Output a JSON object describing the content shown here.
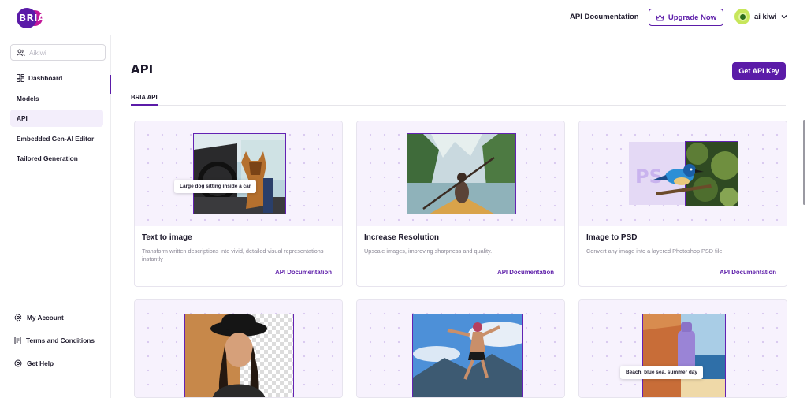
{
  "brand": {
    "logo_text": "BRIA",
    "primary": "#5b1ba8",
    "accent": "#c3179a"
  },
  "header": {
    "api_doc": "API Documentation",
    "upgrade": "Upgrade Now",
    "user_name": "ai kiwi"
  },
  "sidebar": {
    "search_value": "Aikiwi",
    "items": [
      {
        "label": "Dashboard",
        "icon": "dashboard-icon"
      },
      {
        "label": "Models"
      },
      {
        "label": "API",
        "active": true
      },
      {
        "label": "Embedded Gen-AI Editor"
      },
      {
        "label": "Tailored Generation"
      }
    ],
    "footer": [
      {
        "label": "My Account",
        "icon": "gear-icon"
      },
      {
        "label": "Terms and Conditions",
        "icon": "document-icon"
      },
      {
        "label": "Get Help",
        "icon": "help-icon"
      }
    ]
  },
  "main": {
    "title": "API",
    "get_key": "Get API Key",
    "tab": "BRIA API",
    "cards": [
      {
        "title": "Text to image",
        "desc": "Transform written descriptions into vivid, detailed visual representations instantly",
        "link": "API Documentation",
        "caption": "Large dog sitting inside a car"
      },
      {
        "title": "Increase Resolution",
        "desc": "Upscale images, improving sharpness and quality.",
        "link": "API Documentation"
      },
      {
        "title": "Image to PSD",
        "desc": "Convert any image into a layered Photoshop PSD file.",
        "link": "API Documentation",
        "badge": "PS"
      },
      {
        "caption": ""
      },
      {
        "caption": ""
      },
      {
        "caption": "Beach, blue sea, summer day"
      }
    ]
  }
}
